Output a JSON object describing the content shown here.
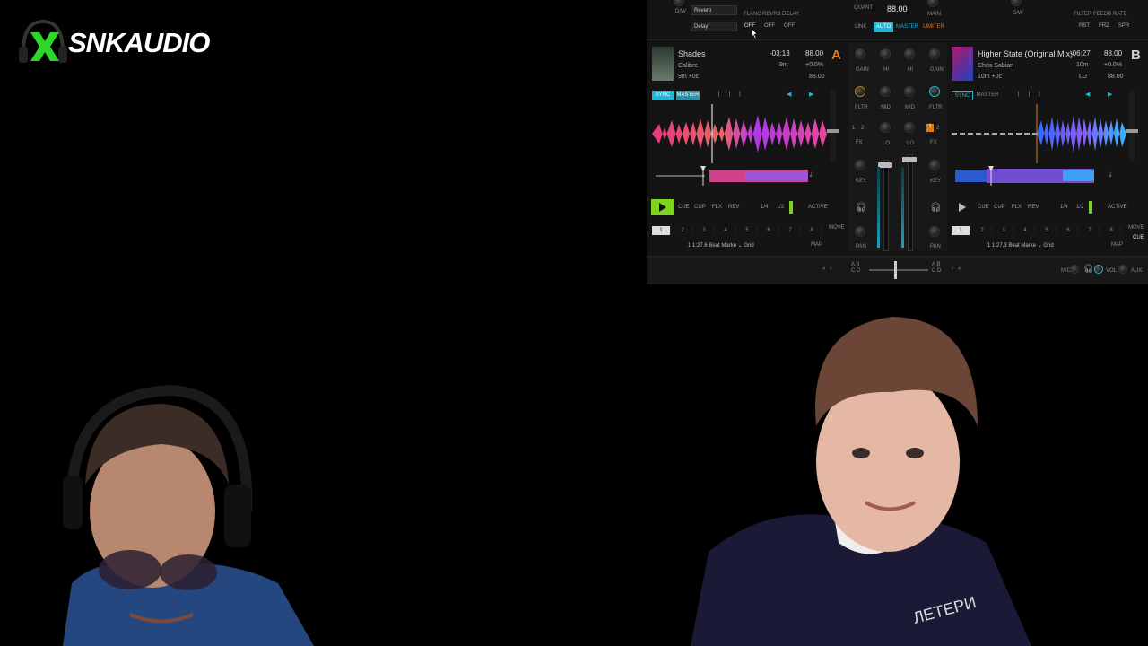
{
  "logo": {
    "text": "SNKAUDIO",
    "icon": "x-headphones-logo"
  },
  "dj": {
    "top": {
      "fx_slot1": "Reverb",
      "fx_slot2": "Delay",
      "dw_label": "D/W",
      "fx_knobs": [
        "FLANG",
        "REVRB",
        "DELAY"
      ],
      "fx_states": [
        "OFF",
        "OFF",
        "OFF"
      ],
      "quant_label": "QUANT",
      "bpm": "88.00",
      "link_label": "LINK",
      "auto_label": "AUTO",
      "master_label": "MASTER",
      "limiter_label": "LIMITER",
      "main_label": "MAIN",
      "right_dw": "D/W",
      "right_fx": [
        "FILTER",
        "FEEDB",
        "RATE"
      ],
      "right_btns": [
        "RST",
        "FRZ",
        "SPR"
      ]
    },
    "deck_a": {
      "letter": "A",
      "title": "Shades",
      "artist": "Calibre",
      "remain": "-03:13",
      "elapsed": "9m",
      "pitch": "+0.0%",
      "key": "9m +0c",
      "bpm": "88.00",
      "bpm2": "88.00",
      "sync": "SYNC",
      "master": "MASTER",
      "transport": [
        "CUE",
        "CUP",
        "FLX",
        "REV"
      ],
      "loop": [
        "1/4",
        "1/2"
      ],
      "active": "ACTIVE",
      "cues": [
        "1",
        "2",
        "3",
        "4",
        "5",
        "6",
        "7",
        "8"
      ],
      "beat_info": "1 1:27.6  Beat Marke ⌄ Grid",
      "map": "MAP",
      "move": "MOVE",
      "cue_lbl": "CUE"
    },
    "deck_b": {
      "letter": "B",
      "title": "Higher State (Original Mix)",
      "artist": "Chris Sabian",
      "remain": "-06:27",
      "elapsed": "10m",
      "pitch": "+0.0%",
      "key": "10m +0c",
      "bpm": "88.00",
      "bpm2": "88.00",
      "ld": "LD",
      "sync": "SYNC",
      "master": "MASTER",
      "transport": [
        "CUE",
        "CUP",
        "FLX",
        "REV"
      ],
      "loop": [
        "1/4",
        "1/2"
      ],
      "active": "ACTIVE",
      "cues": [
        "1",
        "2",
        "3",
        "4",
        "5",
        "6",
        "7",
        "8"
      ],
      "beat_info": "1 1:27.3  Beat Marke ⌄ Grid",
      "map": "MAP",
      "move": "MOVE",
      "cue_lbl": "CUE"
    },
    "mixer": {
      "left_knobs": [
        "GAIN",
        "HI",
        "MID",
        "LO"
      ],
      "right_knobs": [
        "GAIN",
        "HI",
        "MID",
        "LO"
      ],
      "fltr": "FLTR",
      "fx": "FX",
      "key": "KEY",
      "pan": "PAN",
      "fx_nums": [
        "1",
        "2"
      ]
    },
    "bottom": {
      "ab_left": "A B\nC D",
      "ab_right": "A B\nC D",
      "mic": "MIC",
      "vol": "VOL",
      "aux": "AUX"
    }
  },
  "colors": {
    "accent_cyan": "#1fb6d8",
    "deck_a_orange": "#e07b1a",
    "play_green": "#7ed321",
    "panel_bg": "#141414"
  }
}
